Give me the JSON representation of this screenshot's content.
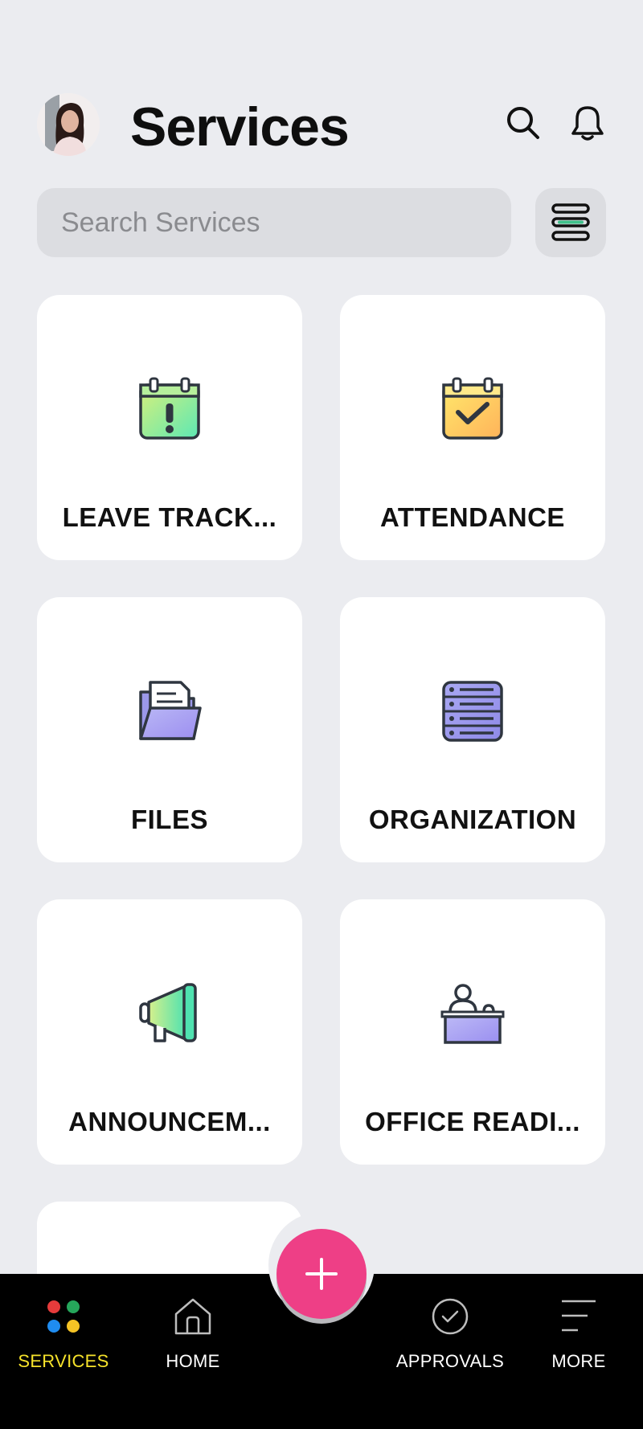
{
  "header": {
    "title": "Services",
    "avatar_icon": "profile-photo",
    "search_icon": "search-icon",
    "notifications_icon": "bell-icon"
  },
  "search": {
    "placeholder": "Search Services",
    "value": ""
  },
  "filter_icon": "menu-lines-icon",
  "services": [
    {
      "label": "LEAVE TRACK...",
      "icon": "calendar-exclamation-icon"
    },
    {
      "label": "ATTENDANCE",
      "icon": "calendar-check-icon"
    },
    {
      "label": "FILES",
      "icon": "folder-icon"
    },
    {
      "label": "ORGANIZATION",
      "icon": "server-stack-icon"
    },
    {
      "label": "ANNOUNCEM...",
      "icon": "megaphone-icon"
    },
    {
      "label": "OFFICE READI...",
      "icon": "reception-desk-icon"
    }
  ],
  "fab": {
    "icon": "plus-icon"
  },
  "bottom_nav": [
    {
      "label": "SERVICES",
      "icon": "four-dots-icon",
      "active": true
    },
    {
      "label": "HOME",
      "icon": "home-icon",
      "active": false
    },
    {
      "label": "APPROVALS",
      "icon": "check-circle-icon",
      "active": false
    },
    {
      "label": "MORE",
      "icon": "menu-icon",
      "active": false
    }
  ],
  "colors": {
    "background": "#ebecf0",
    "card": "#ffffff",
    "fab": "#ee3f86",
    "nav_background": "#000000",
    "nav_active": "#f6e22a"
  }
}
